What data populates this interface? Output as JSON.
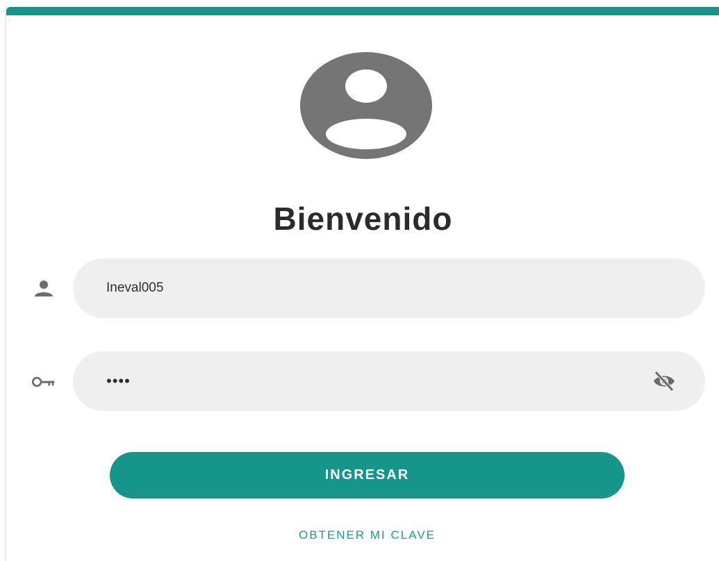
{
  "login": {
    "title": "Bienvenido",
    "username": {
      "value": "Ineval005",
      "icon": "person-icon"
    },
    "password": {
      "value": "••••",
      "icon": "key-icon",
      "toggle_icon": "eye-off-icon"
    },
    "submit_label": "INGRESAR",
    "forgot_label": "OBTENER MI CLAVE"
  },
  "colors": {
    "accent": "#16958a",
    "field_background": "#efefef",
    "avatar": "#757575",
    "title": "#2b2b2b"
  }
}
